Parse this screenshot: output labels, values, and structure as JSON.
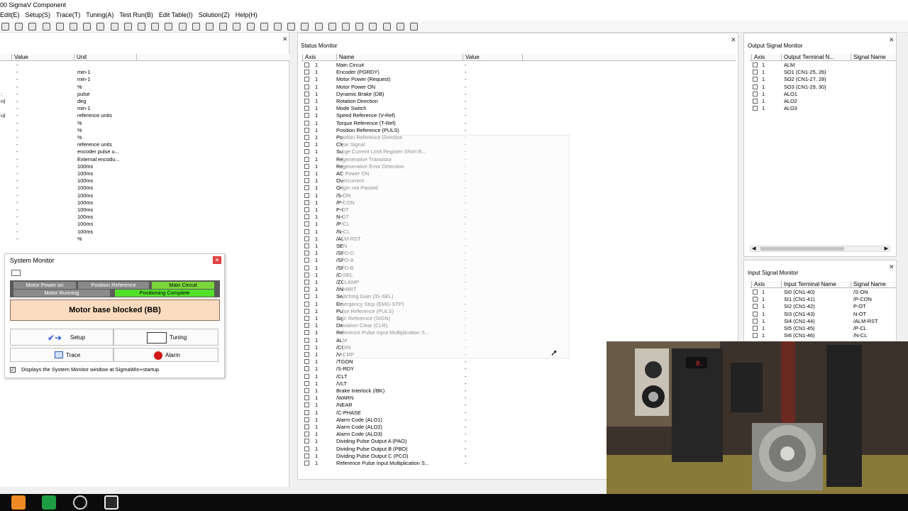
{
  "window": {
    "title": "00 SigmaV Component"
  },
  "menu": [
    "Edit(E)",
    "Setup(S)",
    "Trace(T)",
    "Tuning(A)",
    "Test Run(B)",
    "Edit Table(I)",
    "Solution(Z)",
    "Help(H)"
  ],
  "left_panel": {
    "col_value": "Value",
    "col_unit": "Unit",
    "rows": [
      {
        "side": "",
        "value": "-",
        "unit": ""
      },
      {
        "side": "",
        "value": "-",
        "unit": "min-1"
      },
      {
        "side": "",
        "value": "-",
        "unit": "min-1"
      },
      {
        "side": "",
        "value": "-",
        "unit": "%"
      },
      {
        "side": ":",
        "value": "-",
        "unit": "pulse"
      },
      {
        "side": "n)",
        "value": "-",
        "unit": "deg"
      },
      {
        "side": "",
        "value": "-",
        "unit": "min-1"
      },
      {
        "side": "u)",
        "value": "-",
        "unit": "reference units"
      },
      {
        "side": "",
        "value": "-",
        "unit": "%"
      },
      {
        "side": "",
        "value": "-",
        "unit": "%"
      },
      {
        "side": "",
        "value": "-",
        "unit": "%"
      },
      {
        "side": "",
        "value": "-",
        "unit": "reference units"
      },
      {
        "side": "",
        "value": "-",
        "unit": "encoder pulse u..."
      },
      {
        "side": "",
        "value": "-",
        "unit": "External encodu..."
      },
      {
        "side": "",
        "value": "-",
        "unit": "100ms"
      },
      {
        "side": "",
        "value": "-",
        "unit": "100ms"
      },
      {
        "side": "",
        "value": "-",
        "unit": "100ms"
      },
      {
        "side": "",
        "value": "-",
        "unit": "100ms"
      },
      {
        "side": "",
        "value": "-",
        "unit": "100ms"
      },
      {
        "side": "",
        "value": "-",
        "unit": "100ms"
      },
      {
        "side": "",
        "value": "-",
        "unit": "100ms"
      },
      {
        "side": "",
        "value": "-",
        "unit": "100ms"
      },
      {
        "side": "",
        "value": "-",
        "unit": "100ms"
      },
      {
        "side": "",
        "value": "-",
        "unit": "100ms"
      },
      {
        "side": "",
        "value": "-",
        "unit": "%"
      }
    ]
  },
  "system_monitor": {
    "title": "System Monitor",
    "ind_power_on": "Motor Power on",
    "ind_pos_ref": "Position Reference",
    "ind_main_circuit": "Main Circuit",
    "ind_running": "Motor Running",
    "ind_pos_complete": "Positioning Complete",
    "status": "Motor base blocked (BB)",
    "btn_setup": "Setup",
    "btn_tuning": "Tuning",
    "btn_trace": "Trace",
    "btn_alarm": "Alarm",
    "startup_check": "Displays the System Monitor window at SigmaWin+startup."
  },
  "status_monitor": {
    "title": "Status Monitor",
    "col_axis": "Axis",
    "col_name": "Name",
    "col_value": "Value",
    "rows": [
      {
        "axis": "1",
        "name": "Main Circuit",
        "value": "-"
      },
      {
        "axis": "1",
        "name": "Encoder (PGRDY)",
        "value": "-"
      },
      {
        "axis": "1",
        "name": "Motor Power (Request)",
        "value": "-"
      },
      {
        "axis": "1",
        "name": "Motor Power ON",
        "value": "-"
      },
      {
        "axis": "1",
        "name": "Dynamic Brake (DB)",
        "value": "-"
      },
      {
        "axis": "1",
        "name": "Rotation Direction",
        "value": "-"
      },
      {
        "axis": "1",
        "name": "Mode Switch",
        "value": "-"
      },
      {
        "axis": "1",
        "name": "Speed Reference (V-Ref)",
        "value": "-"
      },
      {
        "axis": "1",
        "name": "Torque Reference (T-Ref)",
        "value": "-"
      },
      {
        "axis": "1",
        "name": "Position Reference (PULS)",
        "value": "-"
      },
      {
        "axis": "1",
        "name": "Position Reference Direction",
        "value": "-"
      },
      {
        "axis": "1",
        "name": "Clear Signal",
        "value": "-"
      },
      {
        "axis": "1",
        "name": "Surge Current Limit Register Short R...",
        "value": "-"
      },
      {
        "axis": "1",
        "name": "Regenerative Transistor",
        "value": "-"
      },
      {
        "axis": "1",
        "name": "Regenerative Error Detection",
        "value": "-"
      },
      {
        "axis": "1",
        "name": "AC Power ON",
        "value": "-"
      },
      {
        "axis": "1",
        "name": "Overcurrent",
        "value": "-"
      },
      {
        "axis": "1",
        "name": "Origin not Passed",
        "value": "-"
      },
      {
        "axis": "1",
        "name": "/S-ON",
        "value": "-"
      },
      {
        "axis": "1",
        "name": "/P-CON",
        "value": "-"
      },
      {
        "axis": "1",
        "name": "P-OT",
        "value": "-"
      },
      {
        "axis": "1",
        "name": "N-OT",
        "value": "-"
      },
      {
        "axis": "1",
        "name": "/P-CL",
        "value": "-"
      },
      {
        "axis": "1",
        "name": "/N-CL",
        "value": "-"
      },
      {
        "axis": "1",
        "name": "/ALM-RST",
        "value": "-"
      },
      {
        "axis": "1",
        "name": "SEN",
        "value": "-"
      },
      {
        "axis": "1",
        "name": "/SPD-D",
        "value": "-"
      },
      {
        "axis": "1",
        "name": "/SPD-A",
        "value": "-"
      },
      {
        "axis": "1",
        "name": "/SPD-B",
        "value": "-"
      },
      {
        "axis": "1",
        "name": "/C-SEL",
        "value": "-"
      },
      {
        "axis": "1",
        "name": "/ZCLAMP",
        "value": "-"
      },
      {
        "axis": "1",
        "name": "/INHIBIT",
        "value": "-"
      },
      {
        "axis": "1",
        "name": "Switching Gain (/G-SEL)",
        "value": "-"
      },
      {
        "axis": "1",
        "name": "Emergency Stop (EMG-STP)",
        "value": "-"
      },
      {
        "axis": "1",
        "name": "Pulse Reference (PULS)",
        "value": "-"
      },
      {
        "axis": "1",
        "name": "Sign Reference (SIGN)",
        "value": "-"
      },
      {
        "axis": "1",
        "name": "Deviation Clear (CLR)",
        "value": "-"
      },
      {
        "axis": "1",
        "name": "Reference Pulse Input Multiplication S...",
        "value": "-"
      },
      {
        "axis": "1",
        "name": "ALM",
        "value": "-"
      },
      {
        "axis": "1",
        "name": "/COIN",
        "value": "-"
      },
      {
        "axis": "1",
        "name": "/V-CMP",
        "value": "-"
      },
      {
        "axis": "1",
        "name": "/TGON",
        "value": "-"
      },
      {
        "axis": "1",
        "name": "/S-RDY",
        "value": "-"
      },
      {
        "axis": "1",
        "name": "/CLT",
        "value": "-"
      },
      {
        "axis": "1",
        "name": "/VLT",
        "value": "-"
      },
      {
        "axis": "1",
        "name": "Brake Interlock (/BK)",
        "value": "-"
      },
      {
        "axis": "1",
        "name": "/WARN",
        "value": "-"
      },
      {
        "axis": "1",
        "name": "/NEAR",
        "value": "-"
      },
      {
        "axis": "1",
        "name": "/C-PHASE",
        "value": "-"
      },
      {
        "axis": "1",
        "name": "Alarm Code (ALO1)",
        "value": "-"
      },
      {
        "axis": "1",
        "name": "Alarm Code (ALO2)",
        "value": "-"
      },
      {
        "axis": "1",
        "name": "Alarm Code (ALO3)",
        "value": "-"
      },
      {
        "axis": "1",
        "name": "Dividing Pulse Output A (PAO)",
        "value": "-"
      },
      {
        "axis": "1",
        "name": "Dividing Pulse Output B (PBO)",
        "value": "-"
      },
      {
        "axis": "1",
        "name": "Dividing Pulse Output C (PCO)",
        "value": "-"
      },
      {
        "axis": "1",
        "name": "Reference Pulse Input Multiplication S...",
        "value": "-"
      }
    ]
  },
  "output_monitor": {
    "title": "Output Signal Monitor",
    "col_axis": "Axis",
    "col_terminal": "Output Terminal N...",
    "col_signal": "Signal Name",
    "rows": [
      {
        "axis": "1",
        "terminal": "ALM",
        "signal": ""
      },
      {
        "axis": "1",
        "terminal": "SO1 (CN1-25, 26)",
        "signal": ""
      },
      {
        "axis": "1",
        "terminal": "SO2 (CN1-27, 28)",
        "signal": ""
      },
      {
        "axis": "1",
        "terminal": "SO3 (CN1-29, 30)",
        "signal": ""
      },
      {
        "axis": "1",
        "terminal": "ALO1",
        "signal": ""
      },
      {
        "axis": "1",
        "terminal": "ALO2",
        "signal": ""
      },
      {
        "axis": "1",
        "terminal": "ALO3",
        "signal": ""
      }
    ]
  },
  "input_monitor": {
    "title": "Input Signal Monitor",
    "col_axis": "Axis",
    "col_terminal": "Input Terminal Name",
    "col_signal": "Signal Name",
    "rows": [
      {
        "axis": "1",
        "terminal": "SI0 (CN1-40)",
        "signal": "/S-ON"
      },
      {
        "axis": "1",
        "terminal": "SI1 (CN1-41)",
        "signal": "/P-CON"
      },
      {
        "axis": "1",
        "terminal": "SI2 (CN1-42)",
        "signal": "P-OT"
      },
      {
        "axis": "1",
        "terminal": "SI3 (CN1-43)",
        "signal": "N-OT"
      },
      {
        "axis": "1",
        "terminal": "SI4 (CN1-44)",
        "signal": "/ALM-RST"
      },
      {
        "axis": "1",
        "terminal": "SI5 (CN1-45)",
        "signal": "/P-CL"
      },
      {
        "axis": "1",
        "terminal": "SI6 (CN1-46)",
        "signal": "/N-CL"
      }
    ]
  },
  "colors": {
    "main_circuit_green": "#7ad63a",
    "pos_complete_green": "#53e02a",
    "indicator_gray": "#8a8a8a",
    "status_bg": "#fcdcc0",
    "taskbar": "#0b0b0b"
  }
}
